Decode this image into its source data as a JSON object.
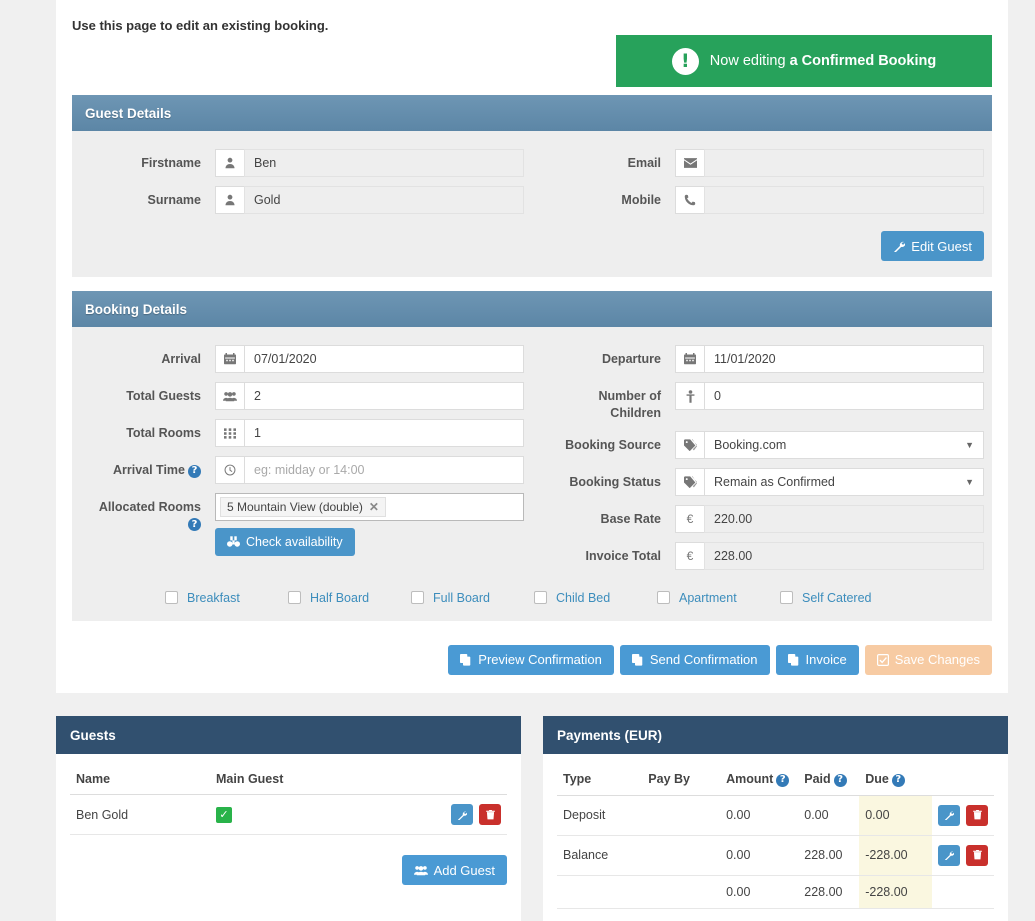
{
  "intro": {
    "text": "Use this page to edit an existing booking."
  },
  "alert": {
    "icon": "exclamation-icon",
    "prefix": "Now editing ",
    "emphasis": "a Confirmed Booking",
    "color": "#27a25b"
  },
  "guest_details": {
    "title": "Guest Details",
    "fields": {
      "firstname_label": "Firstname",
      "firstname_value": "Ben",
      "surname_label": "Surname",
      "surname_value": "Gold",
      "email_label": "Email",
      "email_value": "",
      "mobile_label": "Mobile",
      "mobile_value": ""
    },
    "edit_guest_button": "Edit Guest"
  },
  "booking_details": {
    "title": "Booking Details",
    "arrival_label": "Arrival",
    "arrival_value": "07/01/2020",
    "total_guests_label": "Total Guests",
    "total_guests_value": "2",
    "total_rooms_label": "Total Rooms",
    "total_rooms_value": "1",
    "arrival_time_label": "Arrival Time",
    "arrival_time_placeholder": "eg: midday or  14:00",
    "allocated_rooms_label": "Allocated Rooms",
    "allocated_room_token": "5 Mountain View (double)",
    "check_availability_button": "Check availability",
    "departure_label": "Departure",
    "departure_value": "11/01/2020",
    "children_label_line1": "Number of",
    "children_label_line2": "Children",
    "children_value": "0",
    "booking_source_label": "Booking Source",
    "booking_source_value": "Booking.com",
    "booking_status_label": "Booking Status",
    "booking_status_value": "Remain as Confirmed",
    "base_rate_label": "Base Rate",
    "base_rate_currency": "€",
    "base_rate_value": "220.00",
    "invoice_total_label": "Invoice Total",
    "invoice_total_currency": "€",
    "invoice_total_value": "228.00",
    "options": [
      {
        "label": "Breakfast",
        "checked": false
      },
      {
        "label": "Half Board",
        "checked": false
      },
      {
        "label": "Full Board",
        "checked": false
      },
      {
        "label": "Child Bed",
        "checked": false
      },
      {
        "label": "Apartment",
        "checked": false
      },
      {
        "label": "Self Catered",
        "checked": false
      }
    ]
  },
  "actions": {
    "preview_confirmation": "Preview Confirmation",
    "send_confirmation": "Send Confirmation",
    "invoice": "Invoice",
    "save_changes": "Save Changes"
  },
  "guests_panel": {
    "title": "Guests",
    "columns": [
      "Name",
      "Main Guest"
    ],
    "rows": [
      {
        "name": "Ben Gold",
        "main_guest": true
      }
    ],
    "add_guest_button": "Add Guest"
  },
  "payments_panel": {
    "title": "Payments (EUR)",
    "columns": [
      "Type",
      "Pay By",
      "Amount",
      "Paid",
      "Due"
    ],
    "rows": [
      {
        "type": "Deposit",
        "pay_by": "",
        "amount": "0.00",
        "paid": "0.00",
        "due": "0.00"
      },
      {
        "type": "Balance",
        "pay_by": "",
        "amount": "0.00",
        "paid": "228.00",
        "due": "-228.00"
      },
      {
        "type": "",
        "pay_by": "",
        "amount": "0.00",
        "paid": "228.00",
        "due": "-228.00"
      }
    ]
  }
}
